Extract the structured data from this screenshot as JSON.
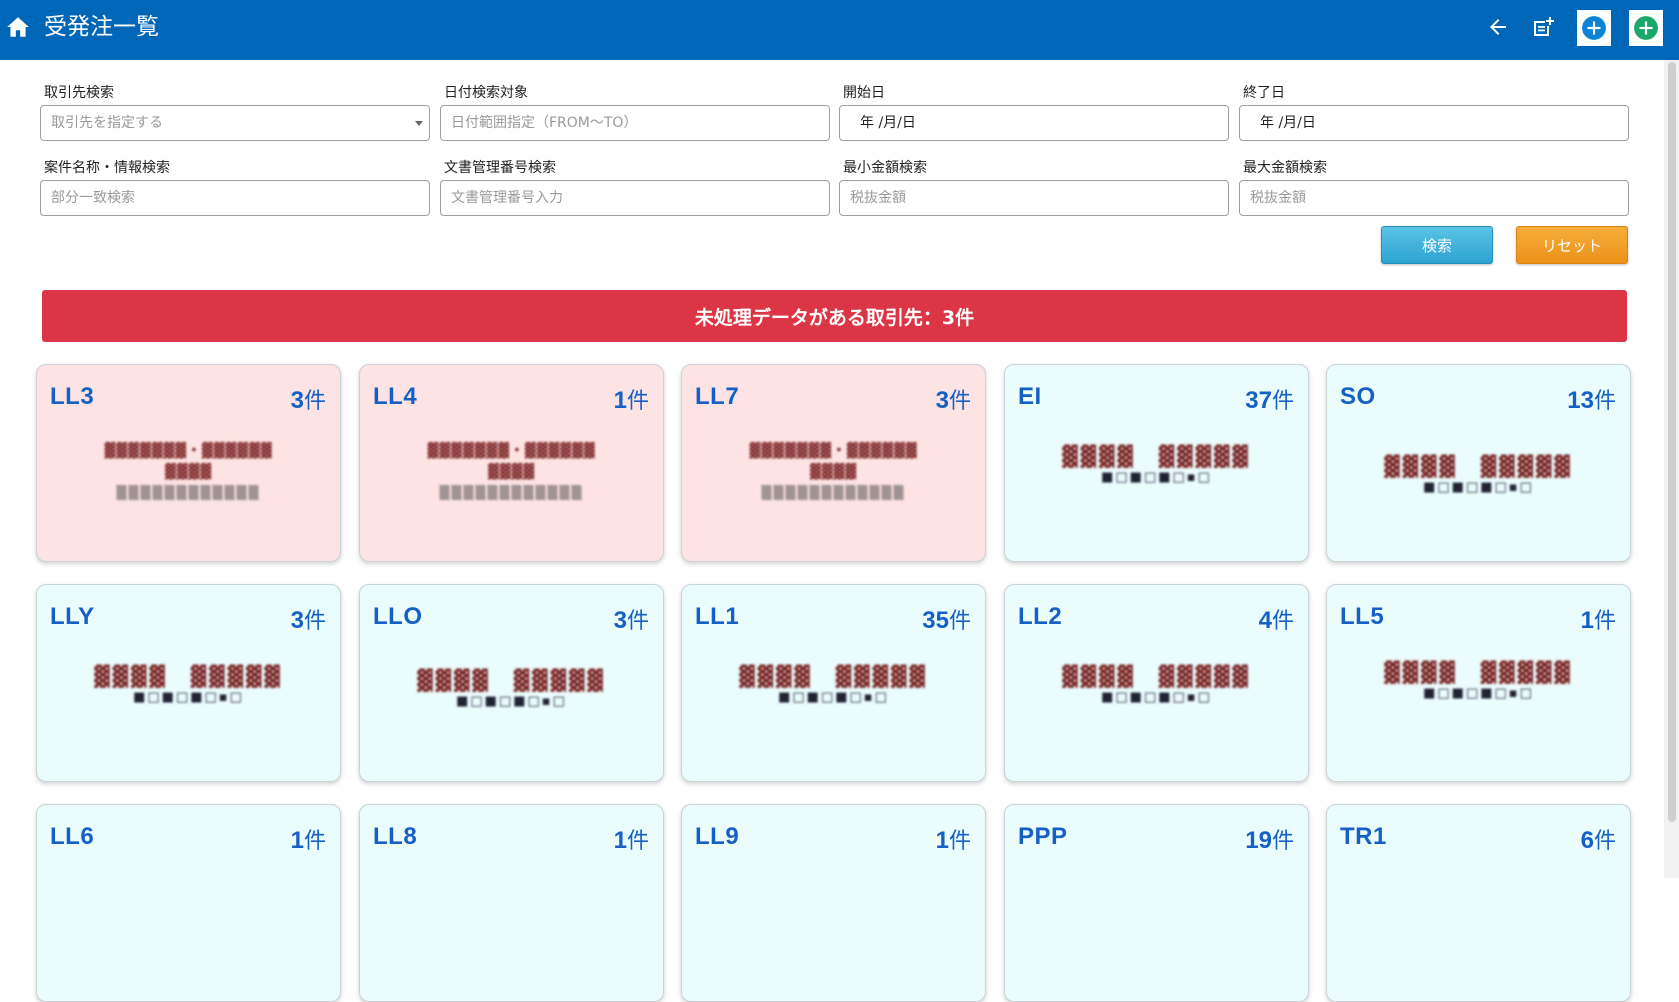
{
  "header": {
    "title": "受発注一覧",
    "icons": [
      "home-icon",
      "arrow-left-icon",
      "document-add-icon",
      "plus-circle-icon",
      "plus-circle-icon"
    ],
    "bg_color": "#0066b8"
  },
  "search": {
    "partner": {
      "label": "取引先検索",
      "placeholder": "取引先を指定する"
    },
    "date_target": {
      "label": "日付検索対象",
      "placeholder": "日付範囲指定（FROM～TO）"
    },
    "start_date": {
      "label": "開始日",
      "value": "年 /月/日"
    },
    "end_date": {
      "label": "終了日",
      "value": "年 /月/日"
    },
    "project": {
      "label": "案件名称・情報検索",
      "placeholder": "部分一致検索"
    },
    "doc_number": {
      "label": "文書管理番号検索",
      "placeholder": "文書管理番号入力"
    },
    "min_amount": {
      "label": "最小金額検索",
      "placeholder": "税抜金額"
    },
    "max_amount": {
      "label": "最大金額検索",
      "placeholder": "税抜金額"
    },
    "search_button": "検索",
    "reset_button": "リセット"
  },
  "alert": {
    "text": "未処理データがある取引先：3件",
    "color": "#dc3545"
  },
  "cards": [
    {
      "code": "LL3",
      "count": "3",
      "unit": "件",
      "status": "pending"
    },
    {
      "code": "LL4",
      "count": "1",
      "unit": "件",
      "status": "pending"
    },
    {
      "code": "LL7",
      "count": "3",
      "unit": "件",
      "status": "pending"
    },
    {
      "code": "EI",
      "count": "37",
      "unit": "件",
      "status": "normal"
    },
    {
      "code": "SO",
      "count": "13",
      "unit": "件",
      "status": "normal"
    },
    {
      "code": "LLY",
      "count": "3",
      "unit": "件",
      "status": "normal"
    },
    {
      "code": "LLO",
      "count": "3",
      "unit": "件",
      "status": "normal"
    },
    {
      "code": "LL1",
      "count": "35",
      "unit": "件",
      "status": "normal"
    },
    {
      "code": "LL2",
      "count": "4",
      "unit": "件",
      "status": "normal"
    },
    {
      "code": "LL5",
      "count": "1",
      "unit": "件",
      "status": "normal"
    },
    {
      "code": "LL6",
      "count": "1",
      "unit": "件",
      "status": "normal"
    },
    {
      "code": "LL8",
      "count": "1",
      "unit": "件",
      "status": "normal"
    },
    {
      "code": "LL9",
      "count": "1",
      "unit": "件",
      "status": "normal"
    },
    {
      "code": "PPP",
      "count": "19",
      "unit": "件",
      "status": "normal"
    },
    {
      "code": "TR1",
      "count": "6",
      "unit": "件",
      "status": "normal"
    }
  ],
  "colors": {
    "pending_card": "#fde3e3",
    "normal_card": "#ebfcfd",
    "accent_text": "#1560c4"
  }
}
